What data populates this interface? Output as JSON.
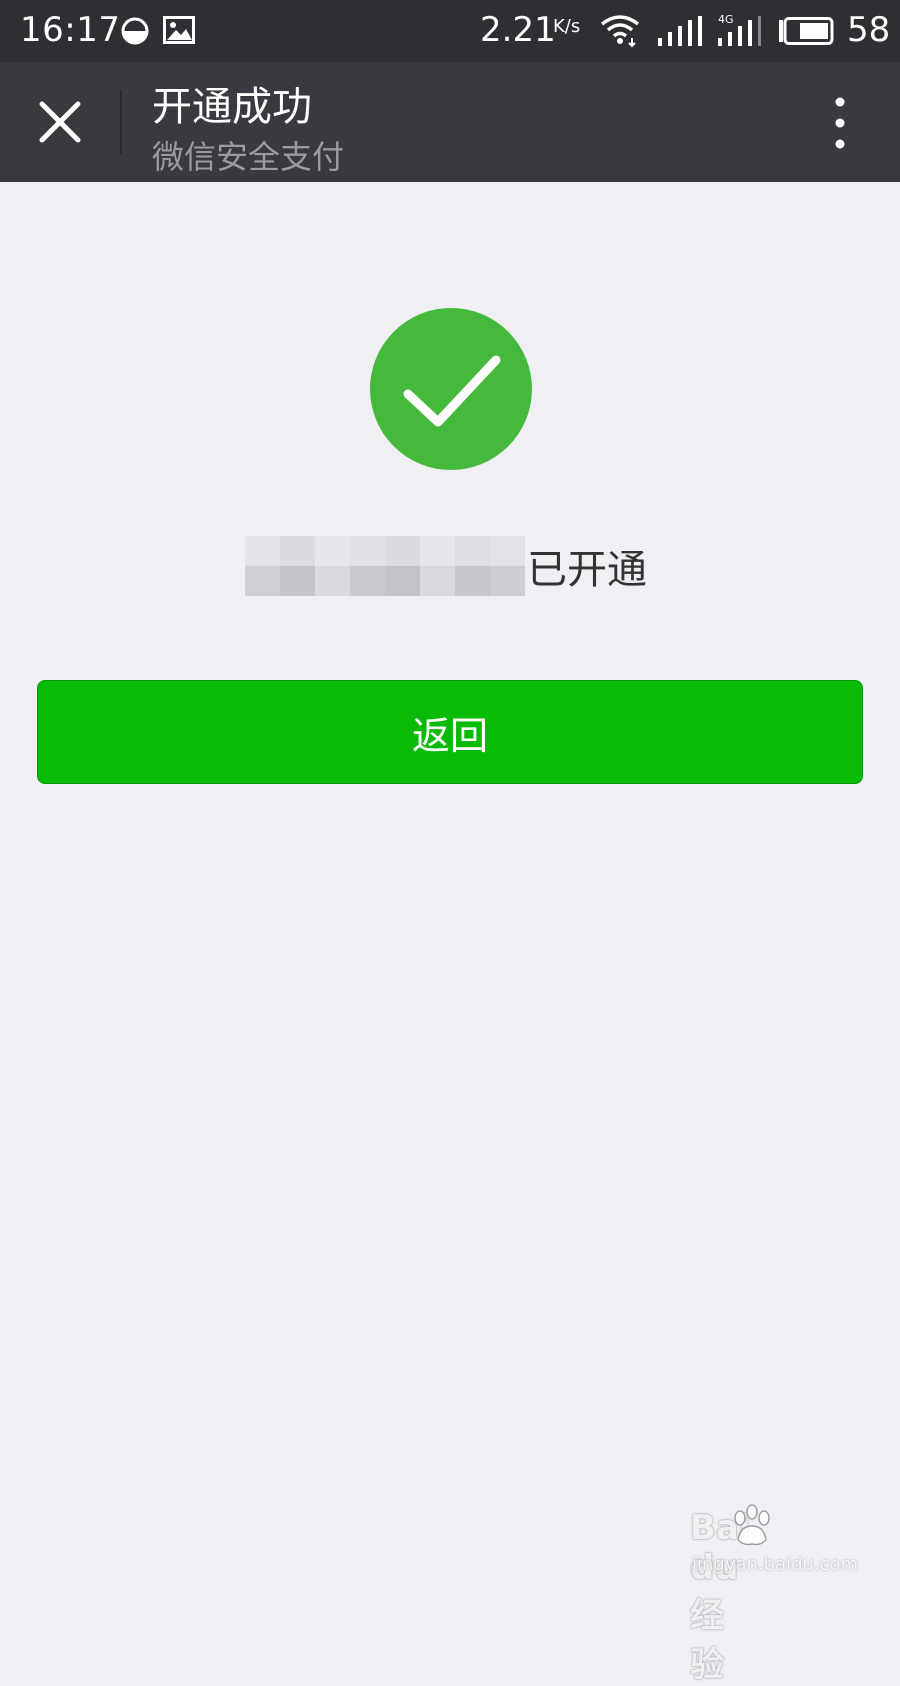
{
  "status_bar": {
    "time": "16:17",
    "net_speed": "2.21",
    "net_speed_unit": "K/s",
    "network_type": "4G",
    "battery_percent": "58"
  },
  "nav_bar": {
    "title": "开通成功",
    "subtitle": "微信安全支付"
  },
  "result": {
    "status_text": "已开通",
    "redacted_label": true
  },
  "actions": {
    "return_label": "返回"
  },
  "watermark": {
    "brand": "Bai  du经验",
    "url": "jingyan.baidu.com"
  },
  "colors": {
    "primary_green": "#09bb07",
    "success_green": "#44b93b",
    "status_bar_bg": "#2e2e33",
    "nav_bar_bg": "#393a3f",
    "page_bg": "#efeff4"
  }
}
